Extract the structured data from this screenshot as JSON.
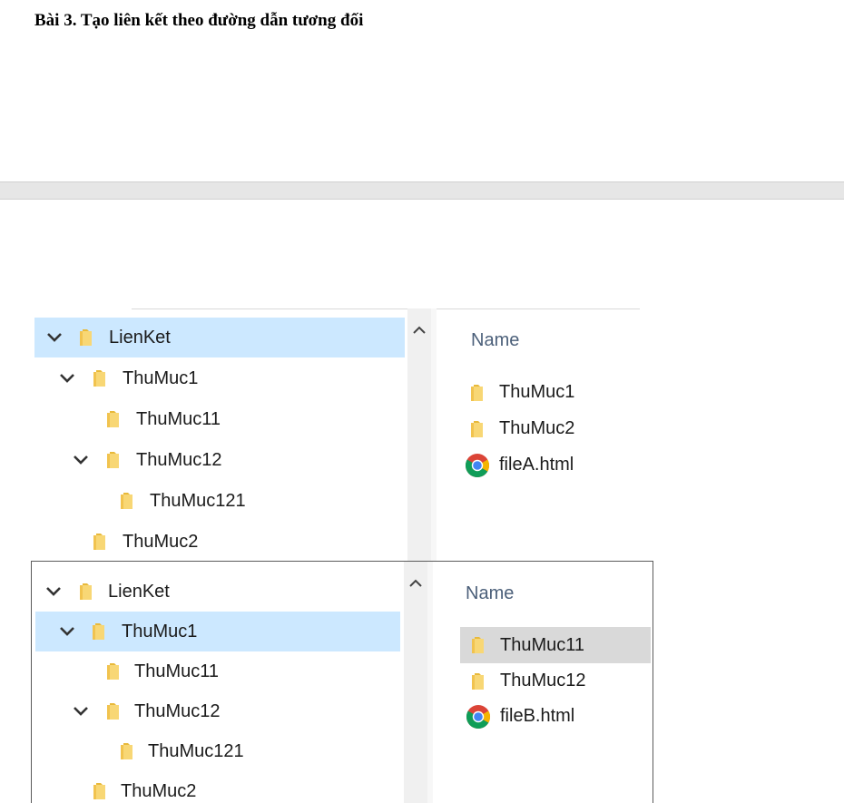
{
  "document": {
    "title": "Bài 3. Tạo liên kết theo đường dẫn tương đối"
  },
  "colors": {
    "selection": "#cce8ff",
    "hover": "#d9d9d9",
    "folder": "#f8d775",
    "header_text": "#4c607a"
  },
  "explorer_1": {
    "tree": [
      {
        "label": "LienKet",
        "expanded": true,
        "selected": true
      },
      {
        "label": "ThuMuc1",
        "expanded": true,
        "selected": false
      },
      {
        "label": "ThuMuc11",
        "expanded": false,
        "selected": false
      },
      {
        "label": "ThuMuc12",
        "expanded": true,
        "selected": false
      },
      {
        "label": "ThuMuc121",
        "expanded": false,
        "selected": false
      },
      {
        "label": "ThuMuc2",
        "expanded": false,
        "selected": false
      }
    ],
    "column_header": "Name",
    "files": [
      {
        "name": "ThuMuc1",
        "icon": "folder-icon"
      },
      {
        "name": "ThuMuc2",
        "icon": "folder-icon"
      },
      {
        "name": "fileA.html",
        "icon": "chrome-icon"
      }
    ]
  },
  "explorer_2": {
    "tree": [
      {
        "label": "LienKet",
        "expanded": true,
        "selected": false
      },
      {
        "label": "ThuMuc1",
        "expanded": true,
        "selected": true
      },
      {
        "label": "ThuMuc11",
        "expanded": false,
        "selected": false
      },
      {
        "label": "ThuMuc12",
        "expanded": true,
        "selected": false
      },
      {
        "label": "ThuMuc121",
        "expanded": false,
        "selected": false
      },
      {
        "label": "ThuMuc2",
        "expanded": false,
        "selected": false
      }
    ],
    "column_header": "Name",
    "files": [
      {
        "name": "ThuMuc11",
        "icon": "folder-icon",
        "hovered": true
      },
      {
        "name": "ThuMuc12",
        "icon": "folder-icon"
      },
      {
        "name": "fileB.html",
        "icon": "chrome-icon"
      }
    ]
  }
}
